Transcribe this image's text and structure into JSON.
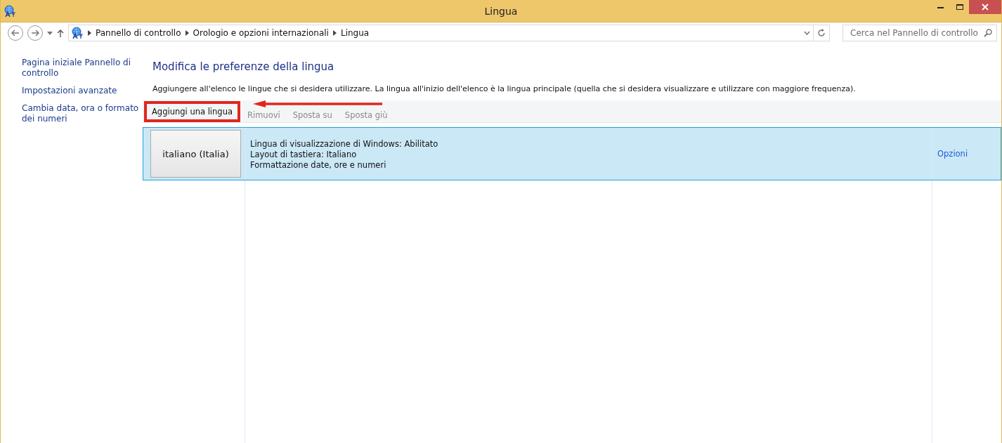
{
  "window": {
    "title": "Lingua"
  },
  "address_bar": {
    "breadcrumb": [
      "Pannello di controllo",
      "Orologio e opzioni internazionali",
      "Lingua"
    ]
  },
  "search": {
    "placeholder": "Cerca nel Pannello di controllo"
  },
  "sidebar": {
    "items": [
      {
        "label": "Pagina iniziale Pannello di controllo"
      },
      {
        "label": "Impostazioni avanzate"
      },
      {
        "label": "Cambia data, ora o formato dei numeri"
      }
    ]
  },
  "heading": "Modifica le preferenze della lingua",
  "description": "Aggiungere all'elenco le lingue che si desidera utilizzare. La lingua all'inizio dell'elenco è la lingua principale (quella che si desidera visualizzare e utilizzare con maggiore frequenza).",
  "toolbar": [
    {
      "label": "Aggiungi una lingua",
      "disabled": false,
      "highlighted": true
    },
    {
      "label": "Rimuovi",
      "disabled": true,
      "highlighted": false
    },
    {
      "label": "Sposta su",
      "disabled": true,
      "highlighted": false
    },
    {
      "label": "Sposta giù",
      "disabled": true,
      "highlighted": false
    }
  ],
  "languages": [
    {
      "name": "italiano (Italia)",
      "selected": true,
      "details": [
        "Lingua di visualizzazione di Windows: Abilitato",
        "Layout di tastiera: Italiano",
        "Formattazione date, ore e numeri"
      ],
      "options": "Opzioni"
    }
  ]
}
